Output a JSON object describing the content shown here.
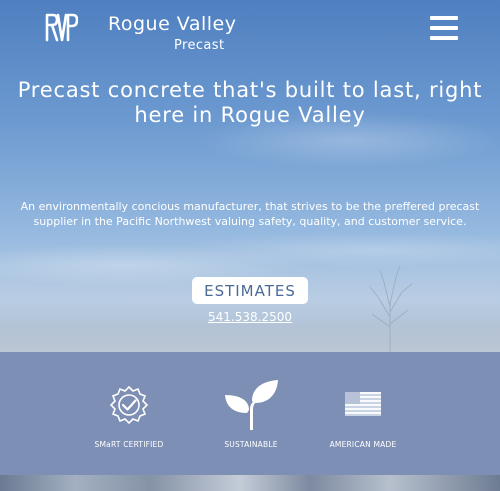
{
  "header": {
    "brand_name": "Rogue Valley",
    "brand_sub": "Precast",
    "logo_icon": "rvp-logo-icon",
    "menu_icon": "hamburger-menu-icon"
  },
  "hero": {
    "headline": "Precast concrete that's built to last, right here in Rogue Valley",
    "intro": "An environmentally concious manufacturer, that strives to be the preffered precast supplier in the Pacific Northwest valuing safety, quality, and customer service.",
    "estimates_label": "ESTIMATES",
    "phone": "541.538.2500"
  },
  "features": [
    {
      "label": "SMaRT CERTIFIED",
      "icon": "certified-badge-icon"
    },
    {
      "label": "SUSTAINABLE",
      "icon": "sprout-leaf-icon"
    },
    {
      "label": "AMERICAN MADE",
      "icon": "us-flag-icon"
    }
  ],
  "colors": {
    "band": "#7d8fb5",
    "button_text": "#4b6a97",
    "text": "#ffffff"
  }
}
